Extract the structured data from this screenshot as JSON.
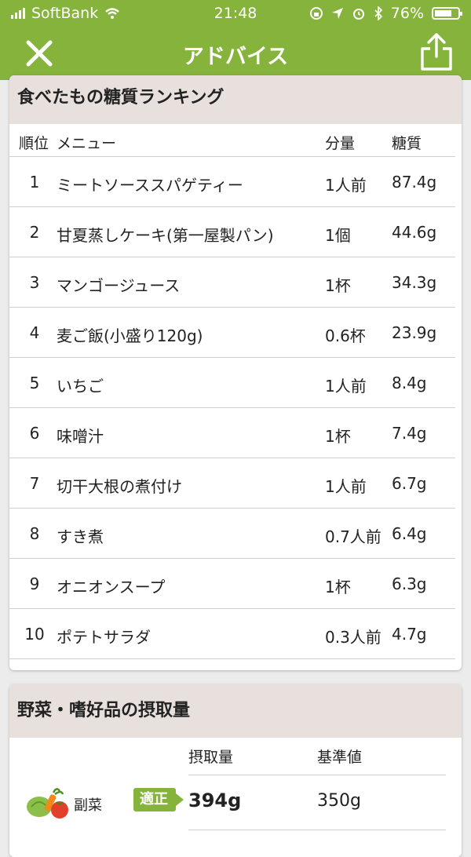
{
  "status_bar": {
    "carrier": "SoftBank",
    "time": "21:48",
    "battery": "76%",
    "battery_level": 0.76
  },
  "nav": {
    "title": "アドバイス"
  },
  "ranking": {
    "title": "食べたもの糖質ランキング",
    "headers": {
      "rank": "順位",
      "menu": "メニュー",
      "qty": "分量",
      "carb": "糖質"
    },
    "rows": [
      {
        "rank": "1",
        "menu": "ミートソーススパゲティー",
        "qty": "1人前",
        "carb": "87.4g"
      },
      {
        "rank": "2",
        "menu": "甘夏蒸しケーキ(第一屋製パン)",
        "qty": "1個",
        "carb": "44.6g"
      },
      {
        "rank": "3",
        "menu": "マンゴージュース",
        "qty": "1杯",
        "carb": "34.3g"
      },
      {
        "rank": "4",
        "menu": "麦ご飯(小盛り120g)",
        "qty": "0.6杯",
        "carb": "23.9g"
      },
      {
        "rank": "5",
        "menu": "いちご",
        "qty": "1人前",
        "carb": "8.4g"
      },
      {
        "rank": "6",
        "menu": "味噌汁",
        "qty": "1杯",
        "carb": "7.4g"
      },
      {
        "rank": "7",
        "menu": "切干大根の煮付け",
        "qty": "1人前",
        "carb": "6.7g"
      },
      {
        "rank": "8",
        "menu": "すき煮",
        "qty": "0.7人前",
        "carb": "6.4g"
      },
      {
        "rank": "9",
        "menu": "オニオンスープ",
        "qty": "1杯",
        "carb": "6.3g"
      },
      {
        "rank": "10",
        "menu": "ポテトサラダ",
        "qty": "0.3人前",
        "carb": "4.7g"
      }
    ]
  },
  "vegetables": {
    "title": "野菜・嗜好品の摂取量",
    "headers": {
      "intake": "摂取量",
      "standard": "基準値"
    },
    "rows": [
      {
        "label": "副菜",
        "status": "適正",
        "intake": "394g",
        "standard": "350g"
      }
    ]
  },
  "colors": {
    "accent": "#86b33c",
    "section_header": "#e7e0dc"
  }
}
